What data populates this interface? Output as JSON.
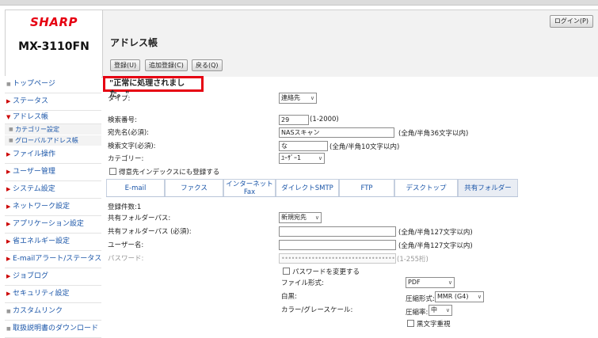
{
  "brand": "SHARP",
  "model": "MX-3110FN",
  "header": {
    "login_label": "ログイン(P)",
    "page_title": "アドレス帳"
  },
  "toolbar": {
    "register_label": "登録(U)",
    "add_register_label": "追加登録(C)",
    "back_label": "戻る(Q)"
  },
  "sidebar": {
    "items": [
      {
        "label": "トップページ"
      },
      {
        "label": "ステータス"
      },
      {
        "label": "アドレス帳"
      },
      {
        "label": "カテゴリー設定"
      },
      {
        "label": "グローバルアドレス帳"
      },
      {
        "label": "ファイル操作"
      },
      {
        "label": "ユーザー管理"
      },
      {
        "label": "システム設定"
      },
      {
        "label": "ネットワーク設定"
      },
      {
        "label": "アプリケーション設定"
      },
      {
        "label": "省エネルギー設定"
      },
      {
        "label": "E-mailアラート/ステータス"
      },
      {
        "label": "ジョブログ"
      },
      {
        "label": "セキュリティ設定"
      },
      {
        "label": "カスタムリンク"
      },
      {
        "label": "取扱説明書のダウンロード"
      }
    ]
  },
  "message": "\"正常に処理されました。\"",
  "form": {
    "type_label": "タイプ:",
    "type_value": "連絡先",
    "search_no_label": "検索番号:",
    "search_no_value": "29",
    "search_no_range": "(1-2000)",
    "dest_name_label": "宛先名(必須):",
    "dest_name_value": "NASスキャン",
    "dest_name_hint": "(全角/半角36文字以内)",
    "search_char_label": "検索文字(必須):",
    "search_char_value": "な",
    "search_char_hint": "(全角/半角10文字以内)",
    "category_label": "カテゴリー:",
    "category_value": "ﾕｰｻﾞｰ1",
    "favorite_label": "得意先インデックスにも登録する"
  },
  "tabs": [
    {
      "label": "E-mail"
    },
    {
      "label": "ファクス"
    },
    {
      "label": "インターネット\nFax"
    },
    {
      "label": "ダイレクトSMTP"
    },
    {
      "label": "FTP"
    },
    {
      "label": "デスクトップ"
    },
    {
      "label": "共有フォルダー"
    }
  ],
  "shared": {
    "count_label": "登録件数:1",
    "folder_path_label": "共有フォルダーパス:",
    "folder_path_value": "新規宛先",
    "folder_path_req_label": "共有フォルダーパス (必須):",
    "folder_path_hint": "(全角/半角127文字以内)",
    "user_label": "ユーザー名:",
    "user_hint": "(全角/半角127文字以内)",
    "password_label": "パスワード:",
    "password_value": "••••••••••••••••••••••••••••••••••",
    "password_hint": "(1-255桁)",
    "change_password_label": "パスワードを変更する",
    "file_format_label": "ファイル形式:",
    "file_format_value": "PDF",
    "bw_label": "白黒:",
    "compression_label": "圧縮形式:",
    "compression_value": "MMR (G4)",
    "color_label": "カラー/グレースケール:",
    "ratio_label": "圧縮率:",
    "ratio_value": "中",
    "bw_emphasis_label": "黒文字重視"
  }
}
